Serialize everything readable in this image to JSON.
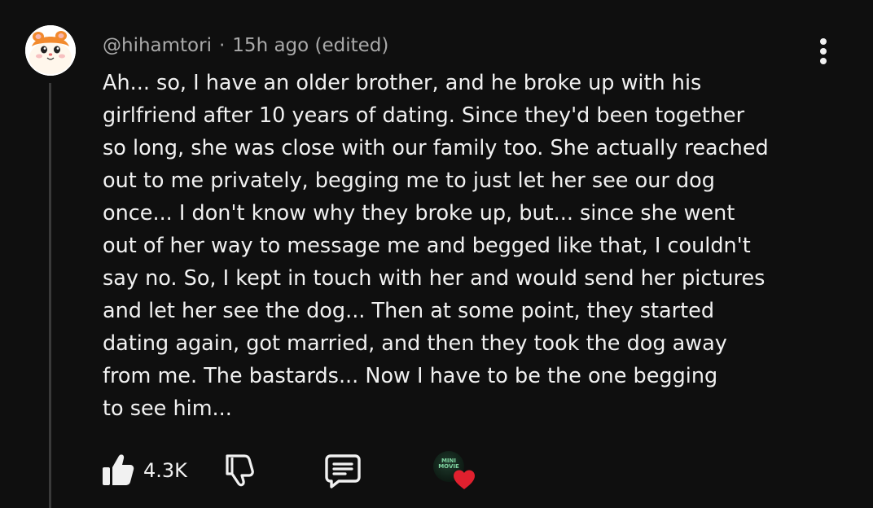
{
  "comment": {
    "author": "@hihamtori",
    "separator": "·",
    "timestamp": "15h ago (edited)",
    "text_lines": [
      "Ah... so, I have an older brother, and he broke up with his",
      "girlfriend after 10 years of dating. Since they'd been together",
      "so long, she was close with our family too. She actually reached",
      "out to me privately, begging me to just let her see our dog",
      "once... I don't know why they broke up, but... since she went",
      "out of her way to message me and begged like that, I couldn't",
      "say no. So, I kept in touch with her and would send her pictures",
      "and let her see the dog... Then at some point, they started",
      "dating again, got married, and then they took the dog away",
      "from me. The bastards... Now I have to be the one begging",
      "to see him..."
    ]
  },
  "actions": {
    "like_count": "4.3K",
    "like_icon": "thumbs-up-icon",
    "dislike_icon": "thumbs-down-icon",
    "reply_icon": "reply-comment-icon",
    "more_icon": "more-vertical-icon"
  },
  "creator_heart": {
    "avatar_label_line1": "MINI",
    "avatar_label_line2": "MOVIE",
    "heart_color": "#e0202e"
  },
  "colors": {
    "background": "#0f0f0f",
    "text": "#f1f1f1",
    "meta": "#aaaaaa"
  }
}
